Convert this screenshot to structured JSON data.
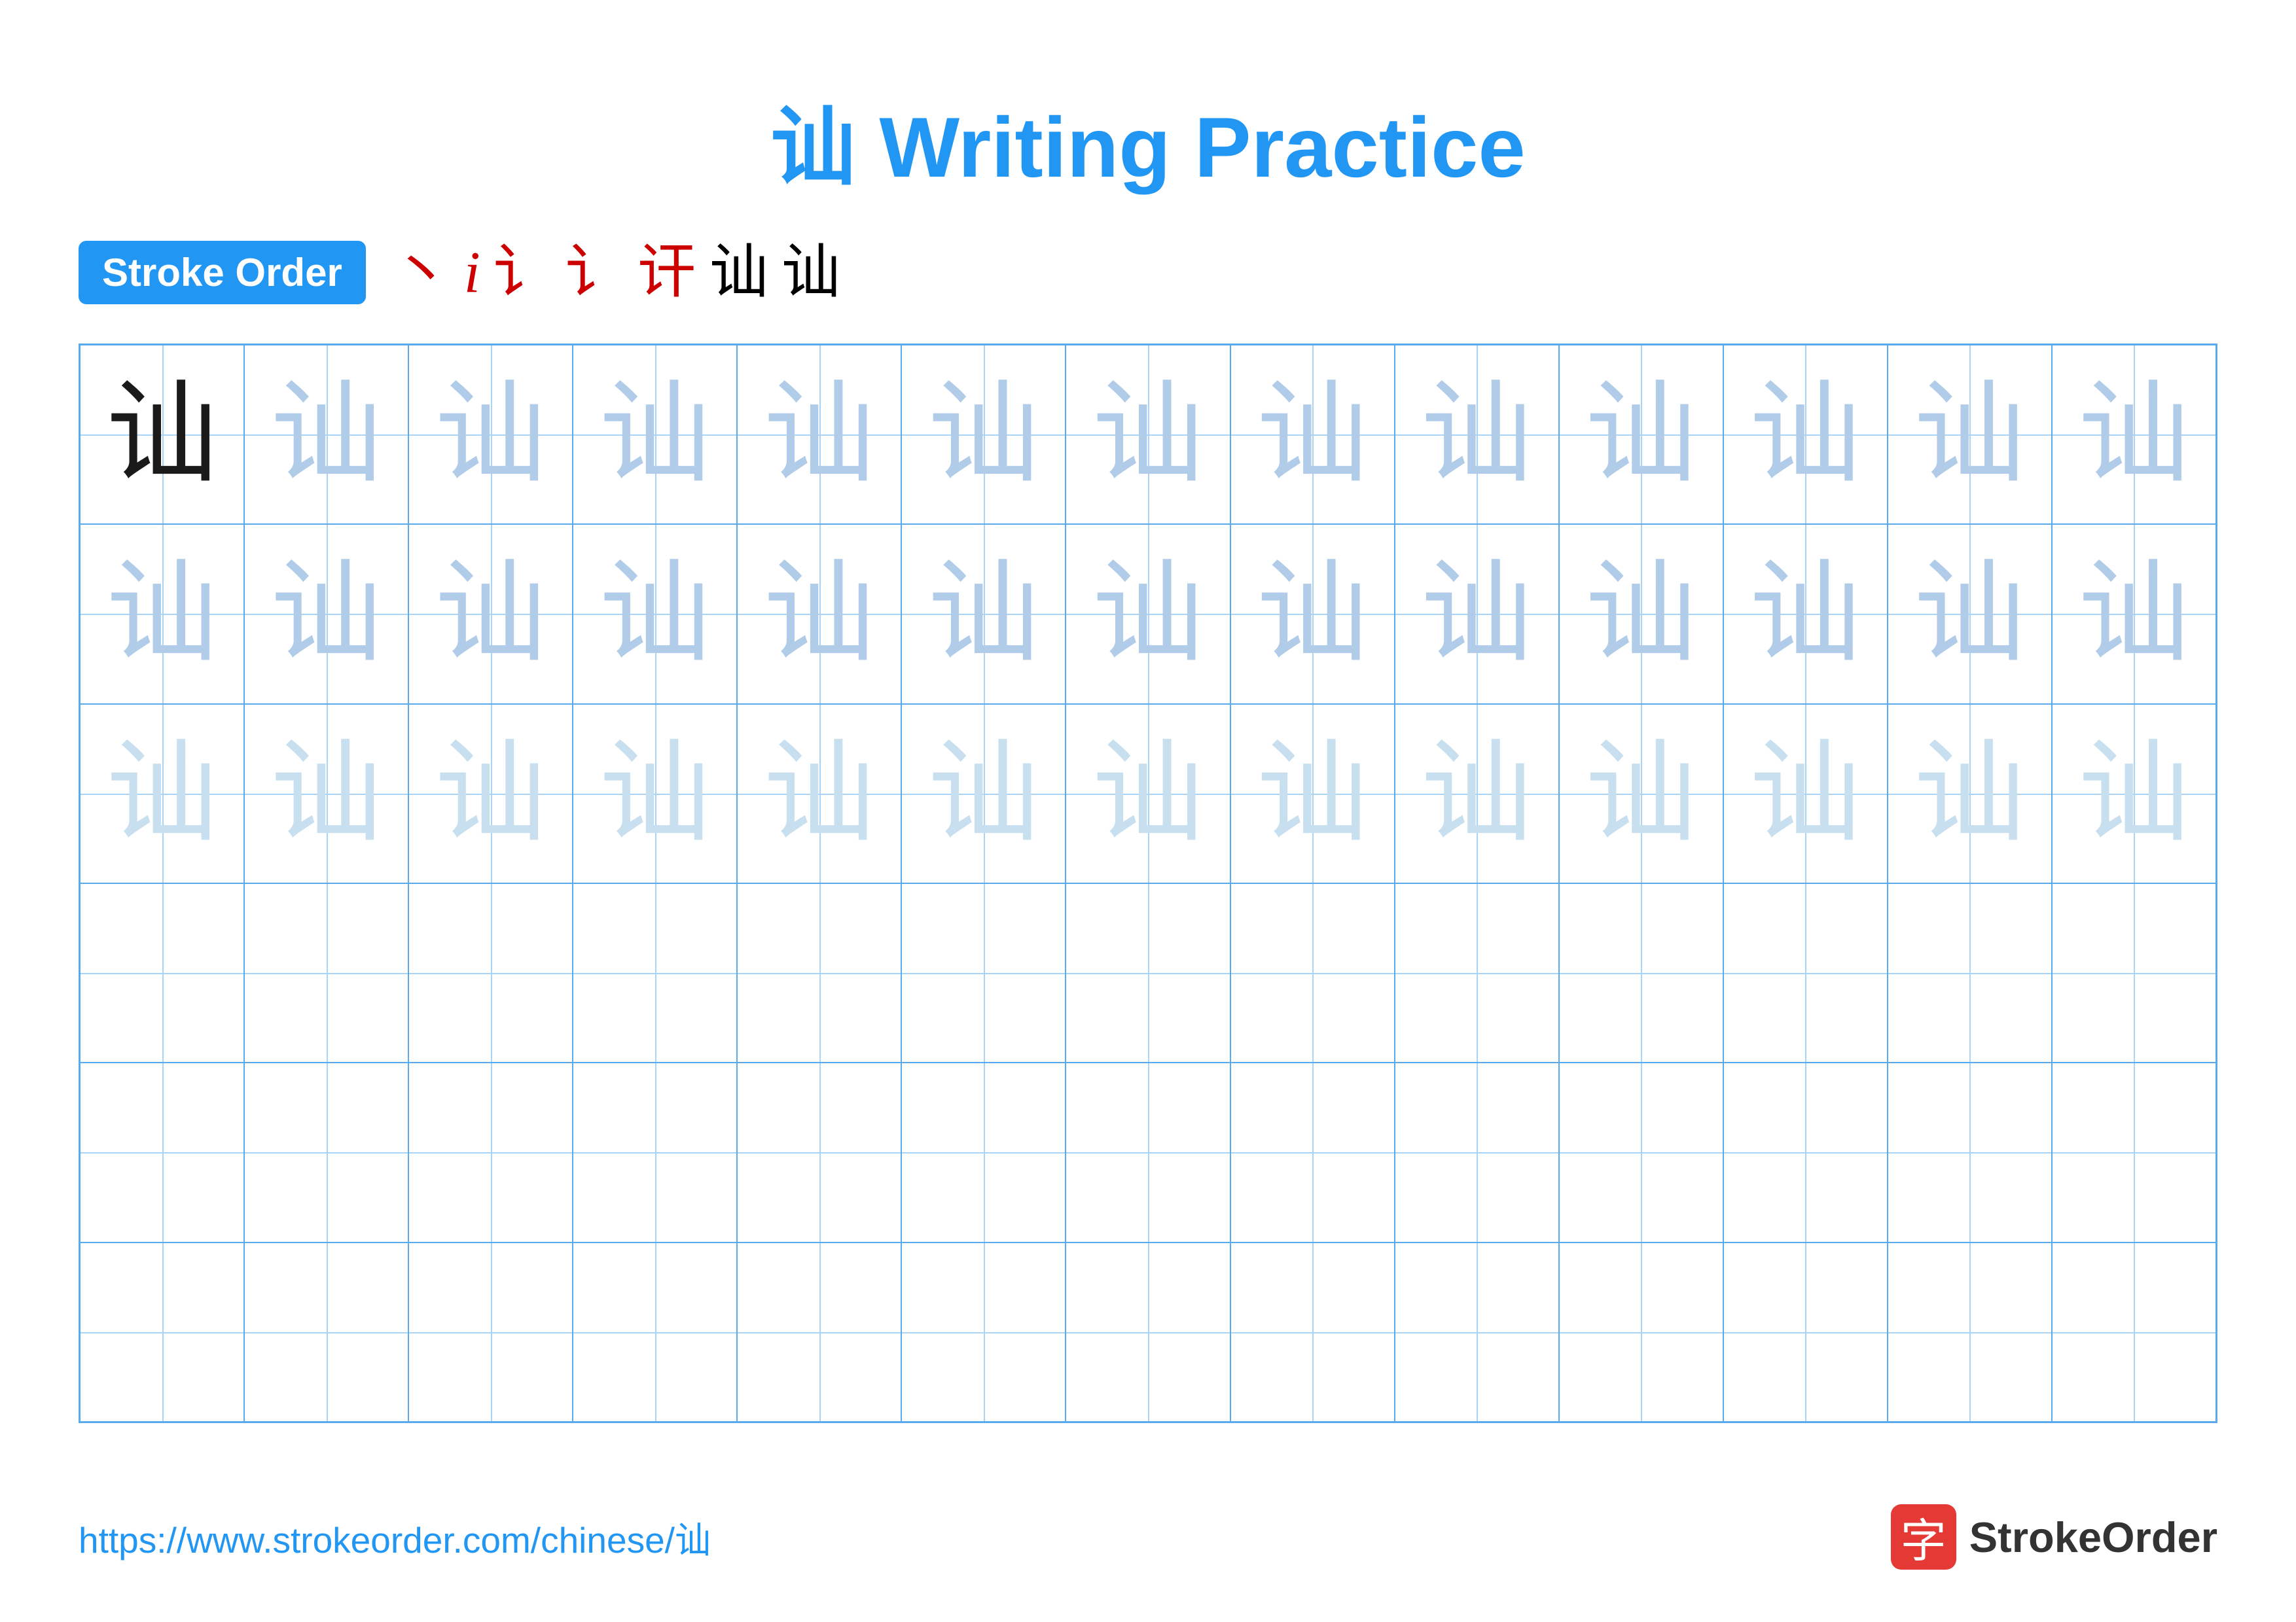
{
  "title": "讪 Writing Practice",
  "stroke_order": {
    "badge_label": "Stroke Order",
    "strokes": [
      "丶",
      "𝑖",
      "讠",
      "讠",
      "讦",
      "讪",
      "讪"
    ]
  },
  "character": "讪",
  "grid": {
    "rows": 6,
    "cols": 13,
    "row1_style": "dark_then_medium",
    "row2_style": "medium",
    "row3_style": "light",
    "rows456_style": "empty"
  },
  "footer": {
    "url": "https://www.strokeorder.com/chinese/讪",
    "logo_char": "字",
    "logo_name": "StrokeOrder"
  }
}
